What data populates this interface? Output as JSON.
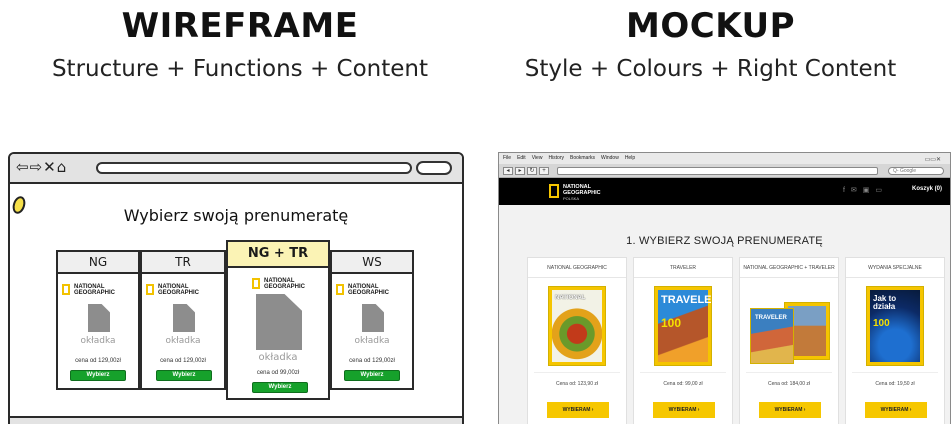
{
  "wireframe_heading": {
    "title": "WIREFRAME",
    "subtitle": "Structure + Functions + Content"
  },
  "mockup_heading": {
    "title": "MOCKUP",
    "subtitle": "Style + Colours + Right Content"
  },
  "wireframe": {
    "nav_icons": "⇦⇨✕⌂",
    "page_title": "Wybierz swoją prenumeratę",
    "brand_text": "NATIONAL GEOGRAPHIC",
    "columns": [
      {
        "header": "NG",
        "cover_label": "okładka",
        "price": "cena od 129,00zł",
        "button": "Wybierz"
      },
      {
        "header": "TR",
        "cover_label": "okładka",
        "price": "cena od 129,00zł",
        "button": "Wybierz"
      },
      {
        "header": "NG + TR",
        "cover_label": "okładka",
        "price": "cena od 99,00zł",
        "button": "Wybierz"
      },
      {
        "header": "WS",
        "cover_label": "okładka",
        "price": "cena od 129,00zł",
        "button": "Wybierz"
      }
    ]
  },
  "mockup": {
    "menu": [
      "File",
      "Edit",
      "View",
      "History",
      "Bookmarks",
      "Window",
      "Help"
    ],
    "search_placeholder": "Q- Google",
    "logo_line1": "NATIONAL",
    "logo_line2": "GEOGRAPHIC",
    "logo_line3": "POLSKA",
    "cart": "Koszyk (0)",
    "page_title": "1. WYBIERZ SWOJĄ PRENUMERATĘ",
    "products": [
      {
        "category": "NATIONAL GEOGRAPHIC",
        "price": "Cena od: 123,90 zł",
        "button": "WYBIERAM  ›",
        "cover_text": "NATIONAL"
      },
      {
        "category": "TRAVELER",
        "price": "Cena od: 99,00 zł",
        "button": "WYBIERAM  ›",
        "cover_text": "TRAVELER",
        "cover_sub": "100"
      },
      {
        "category": "NATIONAL GEOGRAPHIC + TRAVELER",
        "price": "Cena od: 184,00 zł",
        "button": "WYBIERAM  ›",
        "cover_text": "TRAVELER"
      },
      {
        "category": "WYDANIA SPECJALNE",
        "price": "Cena od: 19,50 zł",
        "button": "WYBIERAM  ›",
        "cover_text": "Jak to działa",
        "cover_sub": "100"
      }
    ]
  },
  "colors": {
    "wf_button": "#16a12b",
    "wf_featured_header": "#fbf3b5",
    "mk_button": "#f6c700",
    "mk_header": "#000000",
    "brand_yellow": "#f5c500"
  }
}
